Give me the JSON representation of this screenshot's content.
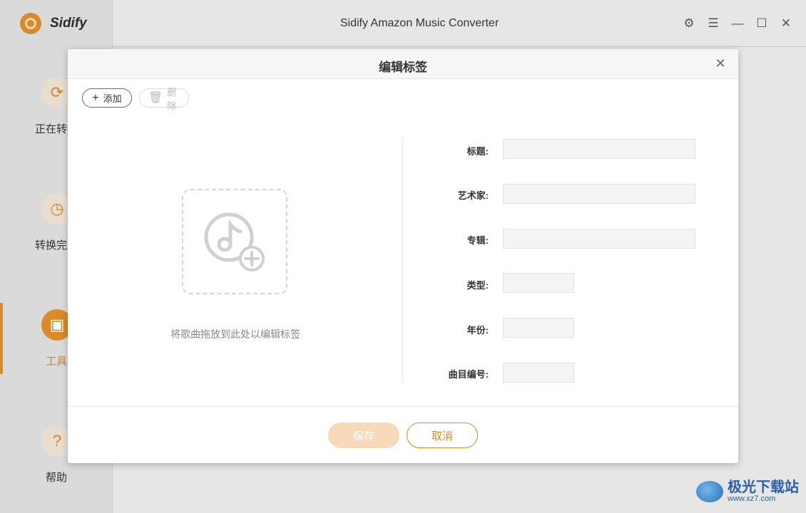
{
  "app": {
    "brand_name": "Sidify",
    "window_title": "Sidify Amazon Music Converter"
  },
  "sidebar": {
    "items": [
      {
        "label": "正在转换",
        "icon": "refresh-icon"
      },
      {
        "label": "转换完成",
        "icon": "clock-icon"
      },
      {
        "label": "工具",
        "icon": "toolbox-icon",
        "active": true
      },
      {
        "label": "帮助",
        "icon": "help-icon"
      }
    ]
  },
  "window_controls": [
    "gear-icon",
    "menu-icon",
    "minimize-icon",
    "maximize-icon",
    "close-icon"
  ],
  "dialog": {
    "title": "编辑标签",
    "toolbar": {
      "add_label": "添加",
      "delete_label": "删除"
    },
    "drop_hint": "将歌曲拖放到此处以编辑标签",
    "fields": {
      "title_label": "标题:",
      "artist_label": "艺术家:",
      "album_label": "专辑:",
      "genre_label": "类型:",
      "year_label": "年份:",
      "track_label": "曲目编号:",
      "title_value": "",
      "artist_value": "",
      "album_value": "",
      "genre_value": "",
      "year_value": "",
      "track_value": ""
    },
    "save_label": "保存",
    "cancel_label": "取消"
  },
  "watermark": {
    "name": "极光下载站",
    "url": "www.xz7.com"
  },
  "colors": {
    "accent": "#d98a2b",
    "accent_light": "#f6d9b8"
  }
}
